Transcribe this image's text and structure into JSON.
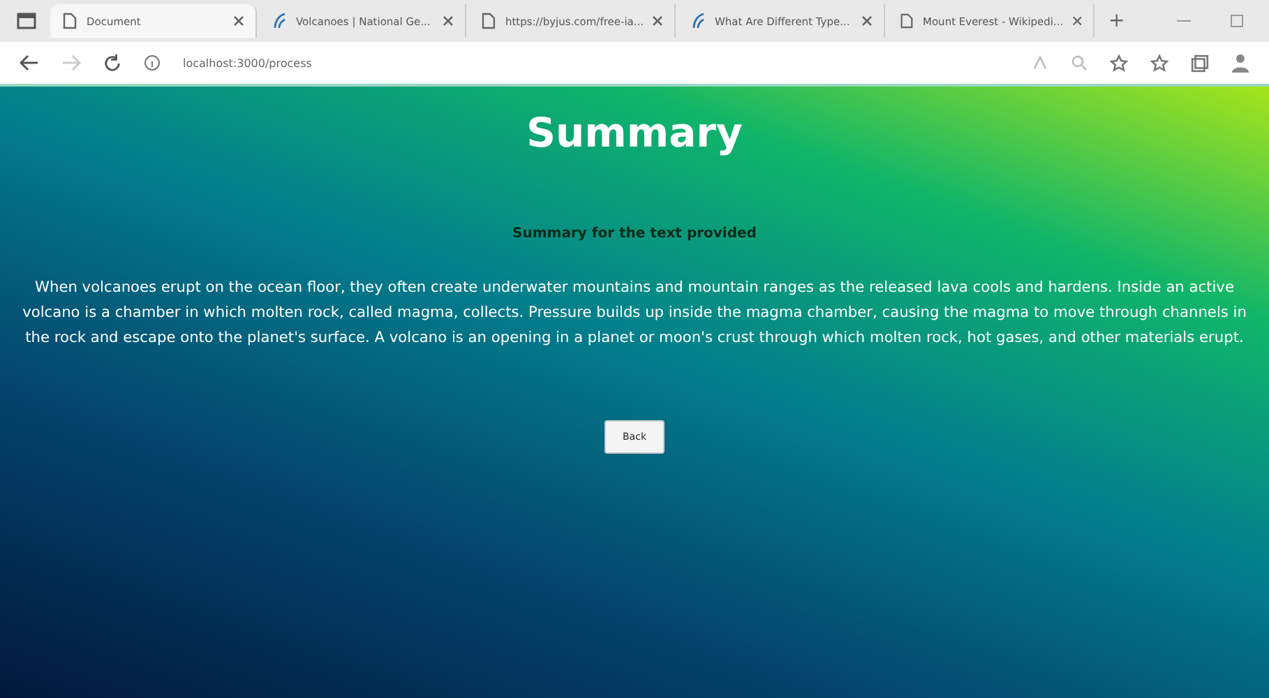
{
  "browser": {
    "tabs": [
      {
        "title": "Document",
        "kind": "page",
        "selected": true
      },
      {
        "title": "Volcanoes | National Ge...",
        "kind": "site",
        "selected": false
      },
      {
        "title": "https://byjus.com/free-ia...",
        "kind": "page",
        "selected": false
      },
      {
        "title": "What Are Different Type...",
        "kind": "site",
        "selected": false
      },
      {
        "title": "Mount Everest - Wikipedi...",
        "kind": "page",
        "selected": false
      }
    ],
    "new_tab": "+",
    "address": "localhost:3000/process"
  },
  "page": {
    "title": "Summary",
    "subtitle": "Summary for the text provided",
    "summary": "When volcanoes erupt on the ocean floor, they often create underwater mountains and mountain ranges as the released lava cools and hardens. Inside an active volcano is a chamber in which molten rock, called magma, collects. Pressure builds up inside the magma chamber, causing the magma to move through channels in the rock and escape onto the planet's surface. A volcano is an opening in a planet or moon's crust through which molten rock, hot gases, and other materials erupt.",
    "button": "Back"
  }
}
